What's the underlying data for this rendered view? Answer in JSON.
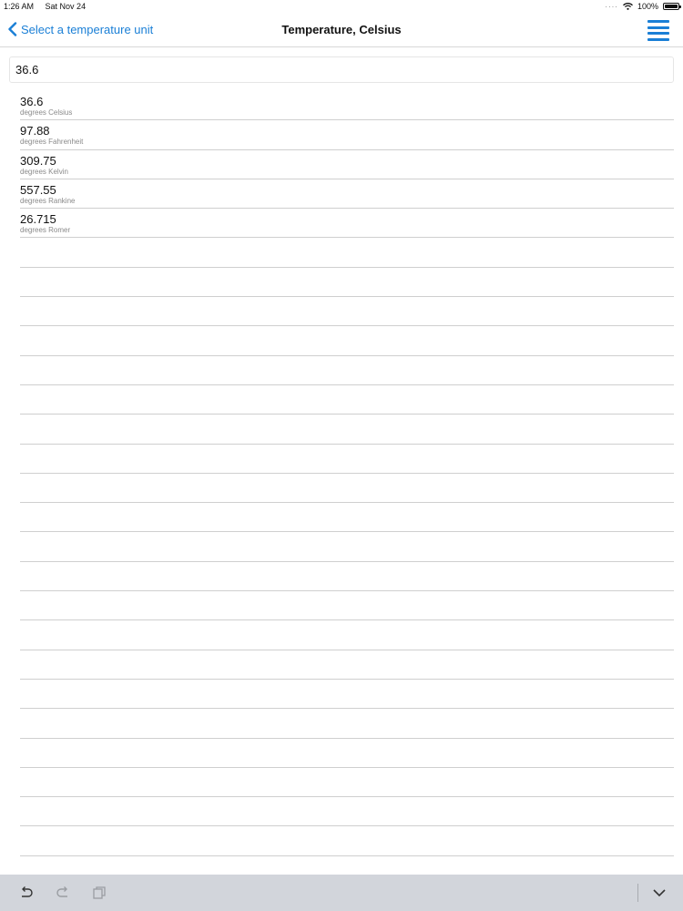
{
  "status_bar": {
    "time": "1:26 AM",
    "date": "Sat Nov 24",
    "battery": "100%",
    "icons": [
      "signal-dots-icon",
      "wifi-icon",
      "battery-icon"
    ]
  },
  "nav": {
    "back_label": "Select a temperature unit",
    "title": "Temperature, Celsius",
    "menu_icon": "hamburger-menu-icon",
    "accent_color": "#1a7fd6"
  },
  "input": {
    "value": "36.6"
  },
  "results": [
    {
      "value": "36.6",
      "unit": "degrees Celsius"
    },
    {
      "value": "97.88",
      "unit": "degrees Fahrenheit"
    },
    {
      "value": "309.75",
      "unit": "degrees Kelvin"
    },
    {
      "value": "557.55",
      "unit": "degrees Rankine"
    },
    {
      "value": "26.715",
      "unit": "degrees Romer"
    }
  ],
  "toolbar": {
    "icons": [
      "undo-icon",
      "redo-icon",
      "paste-icon",
      "keyboard-dismiss-icon"
    ]
  }
}
